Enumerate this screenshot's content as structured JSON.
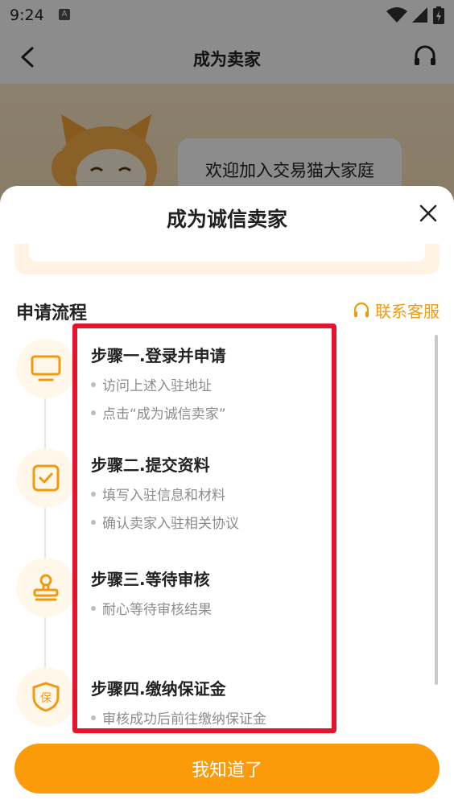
{
  "status_bar": {
    "time": "9:24",
    "sim_badge": "A"
  },
  "background_page": {
    "title": "成为卖家",
    "welcome": "欢迎加入交易猫大家庭"
  },
  "sheet": {
    "title": "成为诚信卖家",
    "section_title": "申请流程",
    "contact_label": "联系客服",
    "accent_color": "#f29a0f",
    "highlight_color": "#e8122d",
    "steps": [
      {
        "title": "步骤一.登录并申请",
        "icon": "monitor-icon",
        "items": [
          "访问上述入驻地址",
          "点击“成为诚信卖家”"
        ]
      },
      {
        "title": "步骤二.提交资料",
        "icon": "checkbox-icon",
        "items": [
          "填写入驻信息和材料",
          "确认卖家入驻相关协议"
        ]
      },
      {
        "title": "步骤三.等待审核",
        "icon": "stamp-icon",
        "items": [
          "耐心等待审核结果"
        ]
      },
      {
        "title": "步骤四.缴纳保证金",
        "icon": "shield-bao-icon",
        "icon_text": "保",
        "items": [
          "审核成功后前往缴纳保证金"
        ]
      }
    ],
    "ok_button": "我知道了",
    "ok_button_color": "#fb9b09"
  }
}
